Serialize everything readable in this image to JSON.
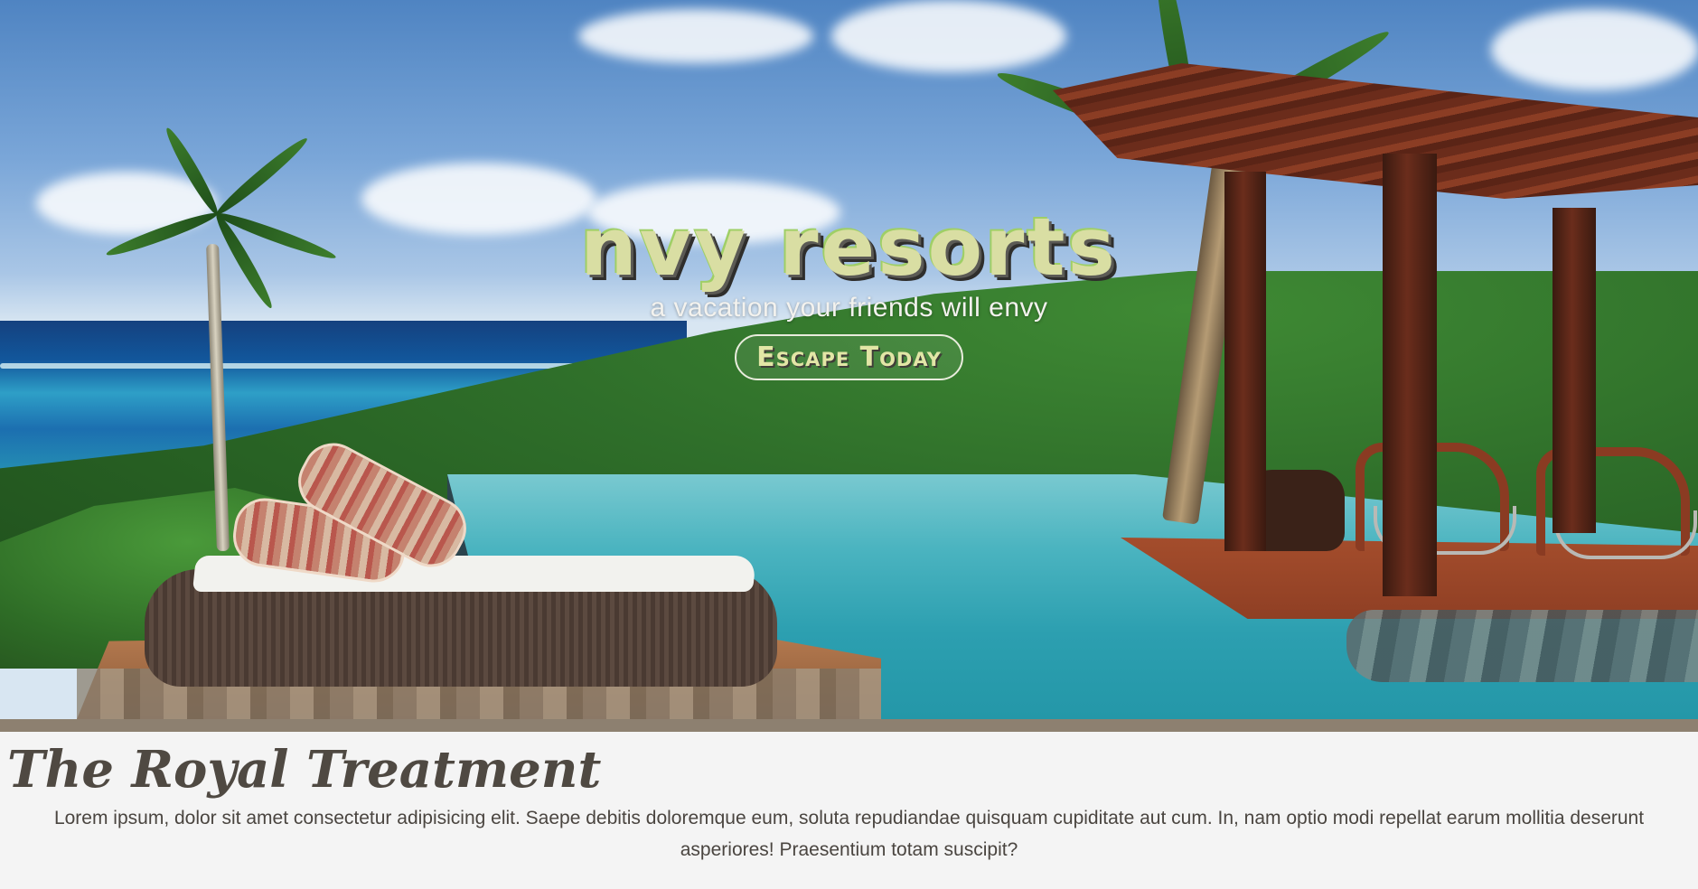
{
  "hero": {
    "brand": "nvy resorts",
    "tagline": "a vacation your friends will envy",
    "cta_label": "Escape Today"
  },
  "section": {
    "title": "The Royal Treatment",
    "body": "Lorem ipsum, dolor sit amet consectetur adipisicing elit. Saepe debitis doloremque eum, soluta repudiandae quisquam cupiditate aut cum. In, nam optio modi repellat earum mollitia deserunt asperiores! Praesentium totam suscipit?"
  },
  "colors": {
    "brand_text": "#d9dea3",
    "divider": "#8d8070",
    "page_background": "#f4f4f4",
    "body_text": "#4a4540"
  }
}
